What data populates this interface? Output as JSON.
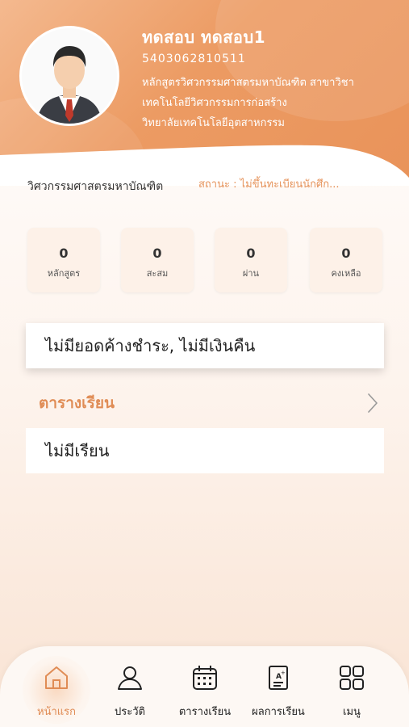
{
  "profile": {
    "name": "ทดสอบ ทดสอบ1",
    "student_id": "5403062810511",
    "program_line1": "หลักสูตรวิศวกรรมศาสตรมหาบัณฑิต สาขาวิชา",
    "program_line2": "เทคโนโลยีวิศวกรรมการก่อสร้าง",
    "program_line3": "วิทยาลัยเทคโนโลยีอุตสาหกรรม"
  },
  "degree": "วิศวกรรมศาสตรมหาบัณฑิต",
  "status": "สถานะ : ไม่ขึ้นทะเบียนนักศึก...",
  "stats": [
    {
      "value": "0",
      "label": "หลักสูตร"
    },
    {
      "value": "0",
      "label": "สะสม"
    },
    {
      "value": "0",
      "label": "ผ่าน"
    },
    {
      "value": "0",
      "label": "คงเหลือ"
    }
  ],
  "payment_notice": "ไม่มียอดค้างชำระ, ไม่มีเงินคืน",
  "schedule": {
    "title": "ตารางเรียน",
    "empty_text": "ไม่มีเรียน"
  },
  "nav": [
    {
      "label": "หน้าแรก",
      "icon": "home-icon",
      "active": true
    },
    {
      "label": "ประวัติ",
      "icon": "user-icon",
      "active": false
    },
    {
      "label": "ตารางเรียน",
      "icon": "calendar-icon",
      "active": false
    },
    {
      "label": "ผลการเรียน",
      "icon": "grade-report-icon",
      "active": false
    },
    {
      "label": "เมนู",
      "icon": "grid-menu-icon",
      "active": false
    }
  ],
  "colors": {
    "accent": "#e08c55",
    "header_start": "#f4b98f",
    "header_end": "#e9935a"
  }
}
